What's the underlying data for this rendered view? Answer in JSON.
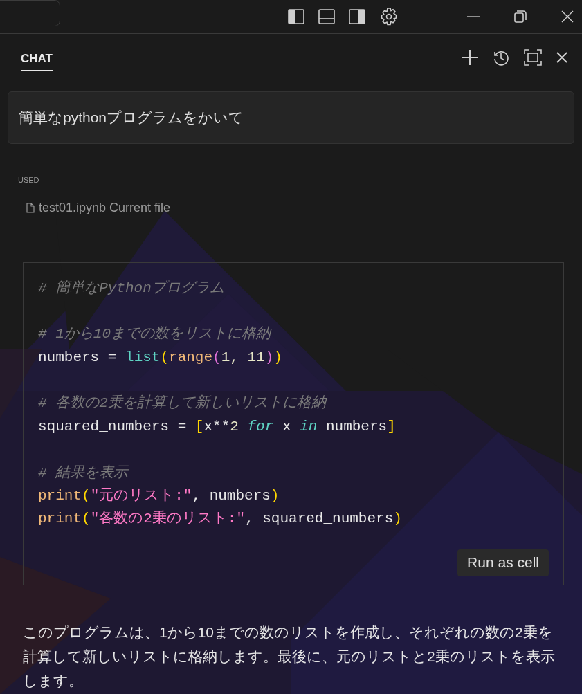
{
  "chat": {
    "tabs": [
      {
        "label": "CHAT",
        "selected": true
      }
    ],
    "prompt": "簡単なpythonプログラムをかいて",
    "used": {
      "label": "USED",
      "file": "test01.ipynb",
      "note": "Current file"
    },
    "code": [
      {
        "kind": "code",
        "tokens": [
          {
            "text": "# 簡単なPythonプログラム",
            "kind": "comment"
          }
        ]
      },
      {
        "kind": "blank"
      },
      {
        "kind": "code",
        "tokens": [
          {
            "text": "# 1から10までの数をリストに格納",
            "kind": "comment"
          }
        ]
      },
      {
        "kind": "code",
        "tokens": [
          {
            "text": "numbers = ",
            "kind": "plain"
          },
          {
            "text": "list",
            "kind": "builtin"
          },
          {
            "text": "(",
            "kind": "paren1"
          },
          {
            "text": "range",
            "kind": "func"
          },
          {
            "text": "(",
            "kind": "paren2"
          },
          {
            "text": "1, 11",
            "kind": "number"
          },
          {
            "text": ")",
            "kind": "paren2"
          },
          {
            "text": ")",
            "kind": "paren1"
          }
        ]
      },
      {
        "kind": "blank"
      },
      {
        "kind": "code",
        "tokens": [
          {
            "text": "# 各数の2乗を計算して新しいリストに格納",
            "kind": "comment"
          }
        ]
      },
      {
        "kind": "code",
        "tokens": [
          {
            "text": "squared_numbers = ",
            "kind": "plain"
          },
          {
            "text": "[",
            "kind": "paren1"
          },
          {
            "text": "x**",
            "kind": "plain"
          },
          {
            "text": "2",
            "kind": "number"
          },
          {
            "text": " for",
            "kind": "keyword"
          },
          {
            "text": " x ",
            "kind": "plain"
          },
          {
            "text": "in",
            "kind": "keyword"
          },
          {
            "text": " numbers",
            "kind": "plain"
          },
          {
            "text": "]",
            "kind": "paren1"
          }
        ]
      },
      {
        "kind": "blank"
      },
      {
        "kind": "code",
        "tokens": [
          {
            "text": "# 結果を表示",
            "kind": "comment"
          }
        ]
      },
      {
        "kind": "code",
        "tokens": [
          {
            "text": "print",
            "kind": "func"
          },
          {
            "text": "(",
            "kind": "paren1"
          },
          {
            "text": "\"元のリスト:\"",
            "kind": "string"
          },
          {
            "text": ", numbers",
            "kind": "plain"
          },
          {
            "text": ")",
            "kind": "paren1"
          }
        ]
      },
      {
        "kind": "code",
        "tokens": [
          {
            "text": "print",
            "kind": "func"
          },
          {
            "text": "(",
            "kind": "paren1"
          },
          {
            "text": "\"各数の2乗のリスト:\"",
            "kind": "string"
          },
          {
            "text": ", squared_numbers",
            "kind": "plain"
          },
          {
            "text": ")",
            "kind": "paren1"
          }
        ]
      }
    ],
    "run_button": "Run as cell",
    "response": "このプログラムは、1から10までの数のリストを作成し、それぞれの数の2乗を計算して新しいリストに格納します。最後に、元のリストと2乗のリストを表示します。"
  }
}
